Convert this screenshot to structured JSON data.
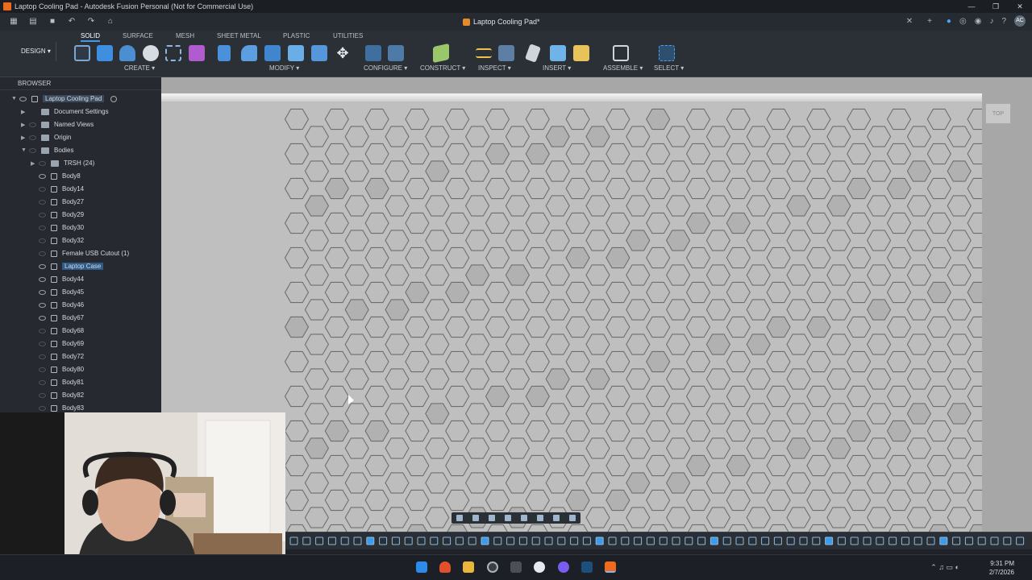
{
  "window": {
    "title": "Laptop Cooling Pad - Autodesk Fusion Personal (Not for Commercial Use)",
    "controls": [
      "—",
      "❐",
      "✕"
    ]
  },
  "document_tab": "Laptop Cooling Pad*",
  "user_initials": "AC",
  "ribbon": {
    "workspace": "DESIGN",
    "tabs": [
      "SOLID",
      "SURFACE",
      "MESH",
      "SHEET METAL",
      "PLASTIC",
      "UTILITIES"
    ],
    "active_tab": "SOLID",
    "groups": [
      "CREATE",
      "MODIFY",
      "CONFIGURE",
      "CONSTRUCT",
      "INSPECT",
      "INSERT",
      "ASSEMBLE",
      "SELECT"
    ]
  },
  "browser": {
    "header": "BROWSER",
    "root": "Laptop Cooling Pad",
    "items": [
      {
        "label": "Document Settings",
        "indent": 1
      },
      {
        "label": "Named Views",
        "indent": 1
      },
      {
        "label": "Origin",
        "indent": 1
      },
      {
        "label": "Bodies",
        "indent": 1
      },
      {
        "label": "TRSH (24)",
        "indent": 2
      },
      {
        "label": "Body8",
        "indent": 2
      },
      {
        "label": "Body14",
        "indent": 2
      },
      {
        "label": "Body27",
        "indent": 2
      },
      {
        "label": "Body29",
        "indent": 2
      },
      {
        "label": "Body30",
        "indent": 2
      },
      {
        "label": "Body32",
        "indent": 2
      },
      {
        "label": "Female USB Cutout (1)",
        "indent": 2
      },
      {
        "label": "Laptop Case",
        "indent": 2,
        "selected": true
      },
      {
        "label": "Body44",
        "indent": 2
      },
      {
        "label": "Body45",
        "indent": 2
      },
      {
        "label": "Body46",
        "indent": 2
      },
      {
        "label": "Body67",
        "indent": 2
      },
      {
        "label": "Body68",
        "indent": 2
      },
      {
        "label": "Body69",
        "indent": 2
      },
      {
        "label": "Body72",
        "indent": 2
      },
      {
        "label": "Body80",
        "indent": 2
      },
      {
        "label": "Body81",
        "indent": 2
      },
      {
        "label": "Body82",
        "indent": 2
      },
      {
        "label": "Body83",
        "indent": 2
      }
    ]
  },
  "viewcube_label": "TOP",
  "taskbar": {
    "time": "9:31 PM",
    "date": "2/7/2026"
  },
  "colors": {
    "accent": "#3d9bea",
    "fusion_orange": "#f06a1d",
    "hex_fill": "#bdbdbd",
    "hex_stroke": "#6e6e6e"
  }
}
